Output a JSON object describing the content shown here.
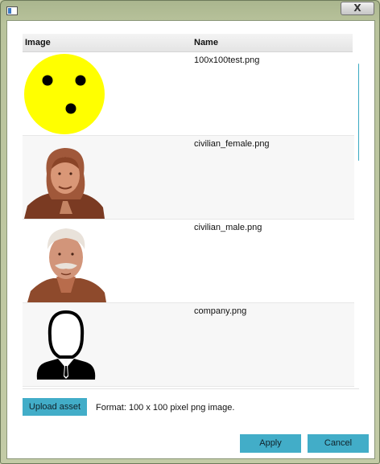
{
  "window": {
    "close_label": "X"
  },
  "grid": {
    "headers": {
      "image": "Image",
      "name": "Name"
    },
    "rows": [
      {
        "name": "100x100test.png",
        "icon": "smiley-test-image"
      },
      {
        "name": "civilian_female.png",
        "icon": "civilian-female-portrait"
      },
      {
        "name": "civilian_male.png",
        "icon": "civilian-male-portrait"
      },
      {
        "name": "company.png",
        "icon": "company-businessman-icon"
      }
    ]
  },
  "upload": {
    "label": "Upload asset",
    "format_text": "Format: 100 x 100 pixel png image."
  },
  "footer": {
    "apply_label": "Apply",
    "cancel_label": "Cancel"
  },
  "colors": {
    "accent": "#42adc8",
    "scroll_thumb": "#3aaac2"
  }
}
